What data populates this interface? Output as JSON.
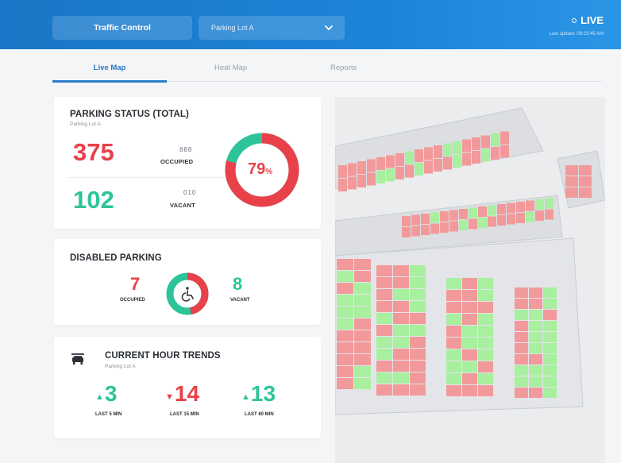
{
  "header": {
    "app_button": "Traffic Control",
    "lot_selector": "Parking Lot A",
    "live_label": "LIVE",
    "last_update": "Last update: 09:23:45 AM"
  },
  "tabs": [
    {
      "label": "Live Map",
      "active": true
    },
    {
      "label": "Heat Map",
      "active": false
    },
    {
      "label": "Reports",
      "active": false
    }
  ],
  "parking_status": {
    "title": "PARKING STATUS (TOTAL)",
    "subtitle": "Parking Lot A",
    "occupied_value": "375",
    "occupied_label": "OCCUPIED",
    "occupied_mini": "888",
    "vacant_value": "102",
    "vacant_label": "VACANT",
    "vacant_mini": "010",
    "percent": "79",
    "percent_sign": "%",
    "occupancy_fraction": 0.79
  },
  "disabled_parking": {
    "title": "DISABLED PARKING",
    "occupied_value": "7",
    "occupied_label": "OCCUPIED",
    "vacant_value": "8",
    "vacant_label": "VACANT",
    "occupancy_fraction": 0.47
  },
  "trends": {
    "title": "CURRENT HOUR TRENDS",
    "subtitle": "Parking Lot A",
    "items": [
      {
        "value": "3",
        "direction": "up",
        "label": "LAST 5 MIN"
      },
      {
        "value": "14",
        "direction": "down",
        "label": "LAST 15 MIN"
      },
      {
        "value": "13",
        "direction": "up",
        "label": "LAST 60 MIN"
      }
    ]
  },
  "colors": {
    "brand_blue": "#1c84d8",
    "occupied_red": "#e8414a",
    "vacant_green": "#2dc49a",
    "map_occupied": "#f2999b",
    "map_vacant": "#a8efa0"
  }
}
